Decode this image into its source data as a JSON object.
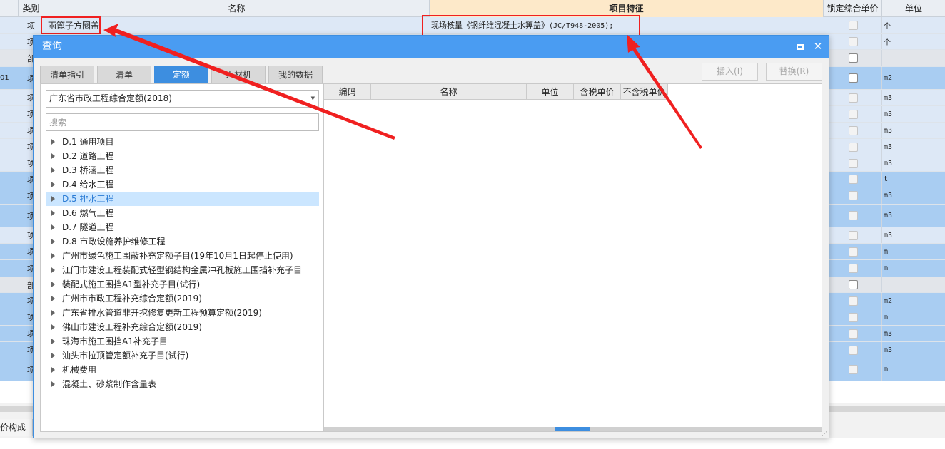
{
  "grid": {
    "headers": {
      "type": "类别",
      "name": "名称",
      "feature": "项目特征",
      "lock": "锁定综合单价",
      "unit": "单位"
    },
    "first_row": {
      "type": "项",
      "name": "雨篦子方圈盖",
      "feature_text": "现场核量《钢纤维混凝土水箅盖》",
      "feature_code": "(JC/T948-2005);",
      "unit": "个"
    },
    "rows": [
      {
        "idx": "",
        "type": "项",
        "unit": "个",
        "color": "c-light"
      },
      {
        "idx": "",
        "type": "部",
        "unit": "",
        "color": "c-gray"
      },
      {
        "idx": "01",
        "type": "项",
        "unit": "m2",
        "color": "c-blue"
      },
      {
        "idx": "",
        "type": "项",
        "unit": "m3",
        "color": "c-light"
      },
      {
        "idx": "",
        "type": "项",
        "unit": "m3",
        "color": "c-light"
      },
      {
        "idx": "",
        "type": "项",
        "unit": "m3",
        "color": "c-light"
      },
      {
        "idx": "",
        "type": "项",
        "unit": "m3",
        "color": "c-light"
      },
      {
        "idx": "",
        "type": "项",
        "unit": "m3",
        "color": "c-light"
      },
      {
        "idx": "",
        "type": "项",
        "unit": "t",
        "color": "c-blue"
      },
      {
        "idx": "",
        "type": "项",
        "unit": "m3",
        "color": "c-blue"
      },
      {
        "idx": "",
        "type": "项",
        "unit": "m3",
        "color": "c-blue"
      },
      {
        "idx": "",
        "type": "项",
        "unit": "m3",
        "color": "c-light"
      },
      {
        "idx": "",
        "type": "项",
        "unit": "m",
        "color": "c-blue"
      },
      {
        "idx": "",
        "type": "项",
        "unit": "m",
        "color": "c-blue"
      },
      {
        "idx": "",
        "type": "部",
        "unit": "",
        "color": "c-gray"
      },
      {
        "idx": "",
        "type": "项",
        "unit": "m2",
        "color": "c-blue"
      },
      {
        "idx": "",
        "type": "项",
        "unit": "m",
        "color": "c-blue"
      },
      {
        "idx": "",
        "type": "项",
        "unit": "m3",
        "color": "c-blue"
      },
      {
        "idx": "",
        "type": "项",
        "unit": "m3",
        "color": "c-blue"
      },
      {
        "idx": "",
        "type": "项",
        "unit": "m",
        "color": "c-blue"
      }
    ],
    "bottom_tab": "价构成"
  },
  "dialog": {
    "title": "查询",
    "tabs": [
      "清单指引",
      "清单",
      "定额",
      "人材机",
      "我的数据"
    ],
    "active_tab": "定额",
    "insert_button": "插入(I)",
    "replace_button": "替换(R)",
    "quota_select": "广东省市政工程综合定额(2018)",
    "search_placeholder": "搜索",
    "tree": [
      "D.1 通用项目",
      "D.2 道路工程",
      "D.3 桥涵工程",
      "D.4 给水工程",
      "D.5 排水工程",
      "D.6 燃气工程",
      "D.7 隧道工程",
      "D.8 市政设施养护维修工程",
      "广州市绿色施工围蔽补充定额子目(19年10月1日起停止使用)",
      "江门市建设工程装配式轻型钢结构金属冲孔板施工围挡补充子目",
      "装配式施工围挡A1型补充子目(试行)",
      "广州市市政工程补充综合定额(2019)",
      "广东省排水管道非开挖修复更新工程预算定额(2019)",
      "佛山市建设工程补充综合定额(2019)",
      "珠海市施工围挡A1补充子目",
      "汕头市拉顶管定额补充子目(试行)",
      "机械费用",
      "混凝土、砂浆制作含量表"
    ],
    "selected_tree_item": "D.5 排水工程",
    "result_columns": [
      "编码",
      "名称",
      "单位",
      "含税单价",
      "不含税单价"
    ]
  },
  "colors": {
    "accent": "#3d8ee0",
    "annotation": "#f02020",
    "feature_header": "#fde9c9"
  }
}
